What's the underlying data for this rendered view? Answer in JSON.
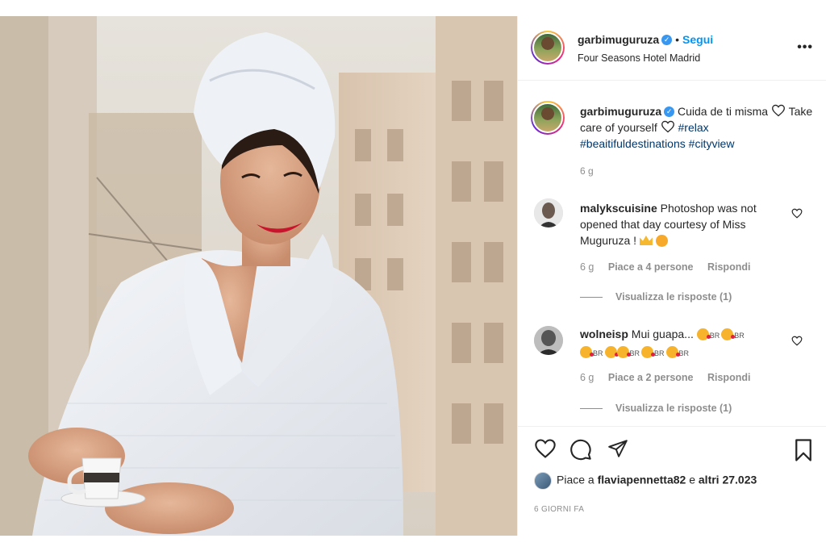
{
  "post": {
    "username": "garbimuguruza",
    "follow_label": "Segui",
    "location": "Four Seasons Hotel Madrid",
    "more_label": "•••"
  },
  "caption": {
    "username": "garbimuguruza",
    "text_part1": "Cuida de ti misma",
    "text_part2": "Take care of yourself",
    "hashtags": [
      "#relax",
      "#beaitifuldestinations",
      "#cityview"
    ],
    "time": "6 g"
  },
  "comments": [
    {
      "username": "malykscuisine",
      "text": "Photoshop was not opened that day courtesy of Miss Muguruza !",
      "emojis": [
        "crown-emoji",
        "star-struck-emoji"
      ],
      "time": "6 g",
      "likes_label": "Piace a 4 persone",
      "reply_label": "Rispondi",
      "view_replies": "Visualizza le risposte (1)"
    },
    {
      "username": "wolneisp",
      "text": "Mui guapa...",
      "emoji_suffix": "BR",
      "time": "6 g",
      "likes_label": "Piace a 2 persone",
      "reply_label": "Rispondi",
      "view_replies": "Visualizza le risposte (1)"
    }
  ],
  "likes": {
    "prefix": "Piace a",
    "user": "flaviapennetta82",
    "connector": "e",
    "others": "altri 27.023"
  },
  "timestamp": "6 GIORNI FA",
  "colors": {
    "link_blue": "#0095f6",
    "hashtag": "#00376b",
    "muted": "#8e8e8e",
    "verified": "#3897f0"
  },
  "icons": [
    "heart-icon",
    "comment-icon",
    "share-icon",
    "bookmark-icon",
    "verified-icon",
    "more-icon"
  ]
}
